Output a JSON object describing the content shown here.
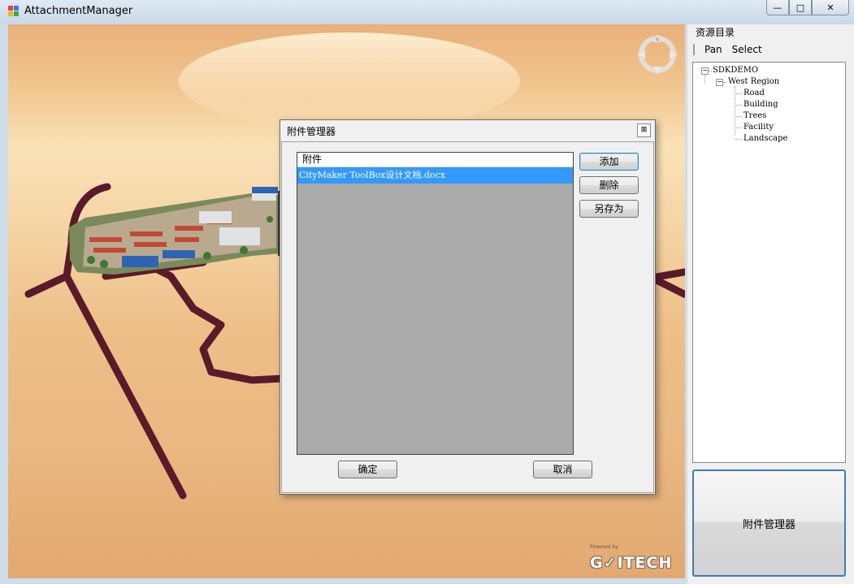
{
  "window": {
    "title": "AttachmentManager",
    "controls": {
      "minimize": "—",
      "restore": "□",
      "close": "✕"
    }
  },
  "viewport": {
    "logo_powered": "Powered by",
    "logo": "G✓ITECH"
  },
  "panel": {
    "title": "资源目录",
    "toolbar": [
      "Pan",
      "Select"
    ],
    "tree": {
      "root": "SDKDEMO",
      "child": "West Region",
      "leaves": [
        "Road",
        "Building",
        "Trees",
        "Facility",
        "Landscape"
      ]
    },
    "big_button": "附件管理器"
  },
  "dialog": {
    "title": "附件管理器",
    "close": "⊠",
    "list_header": "附件",
    "items": [
      "CityMaker ToolBox设计文档.docx"
    ],
    "buttons": {
      "add": "添加",
      "delete": "删除",
      "save_as": "另存为",
      "ok": "确定",
      "cancel": "取消"
    }
  }
}
